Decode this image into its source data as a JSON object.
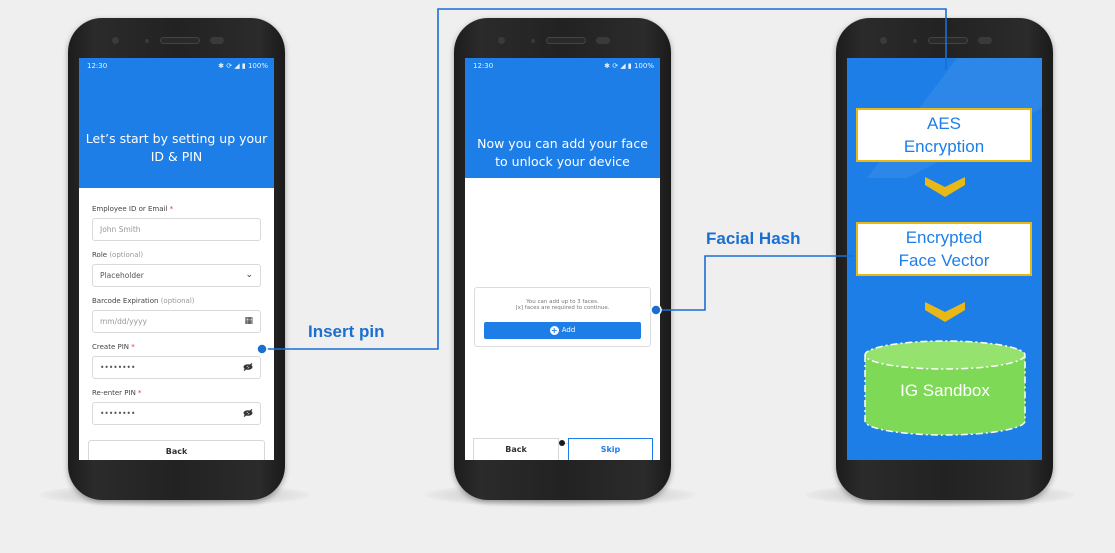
{
  "phone1": {
    "status_time": "12:30",
    "status_right": "✱ ⟳ ◢ ▮ 100%",
    "title": "Let’s start by setting up your ID & PIN",
    "fields": [
      {
        "label": "Employee ID or Email",
        "label_suffix": "",
        "required": "*",
        "value": "John Smith",
        "icon": ""
      },
      {
        "label": "Role",
        "label_suffix": "(optional)",
        "required": "",
        "value": "Placeholder",
        "icon": "chevron-down-icon"
      },
      {
        "label": "Barcode Expiration",
        "label_suffix": "(optional)",
        "required": "",
        "value": "mm/dd/yyyy",
        "icon": "calendar-icon"
      },
      {
        "label": "Create PIN",
        "label_suffix": "",
        "required": "*",
        "value": "••••••••",
        "icon": "eye-off-icon"
      },
      {
        "label": "Re-enter PIN",
        "label_suffix": "",
        "required": "*",
        "value": "••••••••",
        "icon": "eye-off-icon"
      }
    ],
    "back_label": "Back"
  },
  "phone2": {
    "status_time": "12:30",
    "status_right": "✱ ⟳ ◢ ▮ 100%",
    "title": "Now you can add your face to unlock your device",
    "face_text_1": "You can add up to 3 faces.",
    "face_text_2": "[x] faces are required to continue.",
    "add_label": "Add",
    "back_label": "Back",
    "skip_label": "Skip"
  },
  "phone3": {
    "box1": [
      "AES",
      "Encryption"
    ],
    "box2": [
      "Encrypted",
      "Face Vector"
    ],
    "cylinder_label": "IG Sandbox"
  },
  "callouts": {
    "insert_pin": "Insert pin",
    "facial_hash": "Facial Hash"
  },
  "colors": {
    "accent_blue": "#1e7ee8",
    "callout_blue": "#1a6fd1",
    "box_border": "#e8b817",
    "cylinder_green": "#7ed957"
  }
}
